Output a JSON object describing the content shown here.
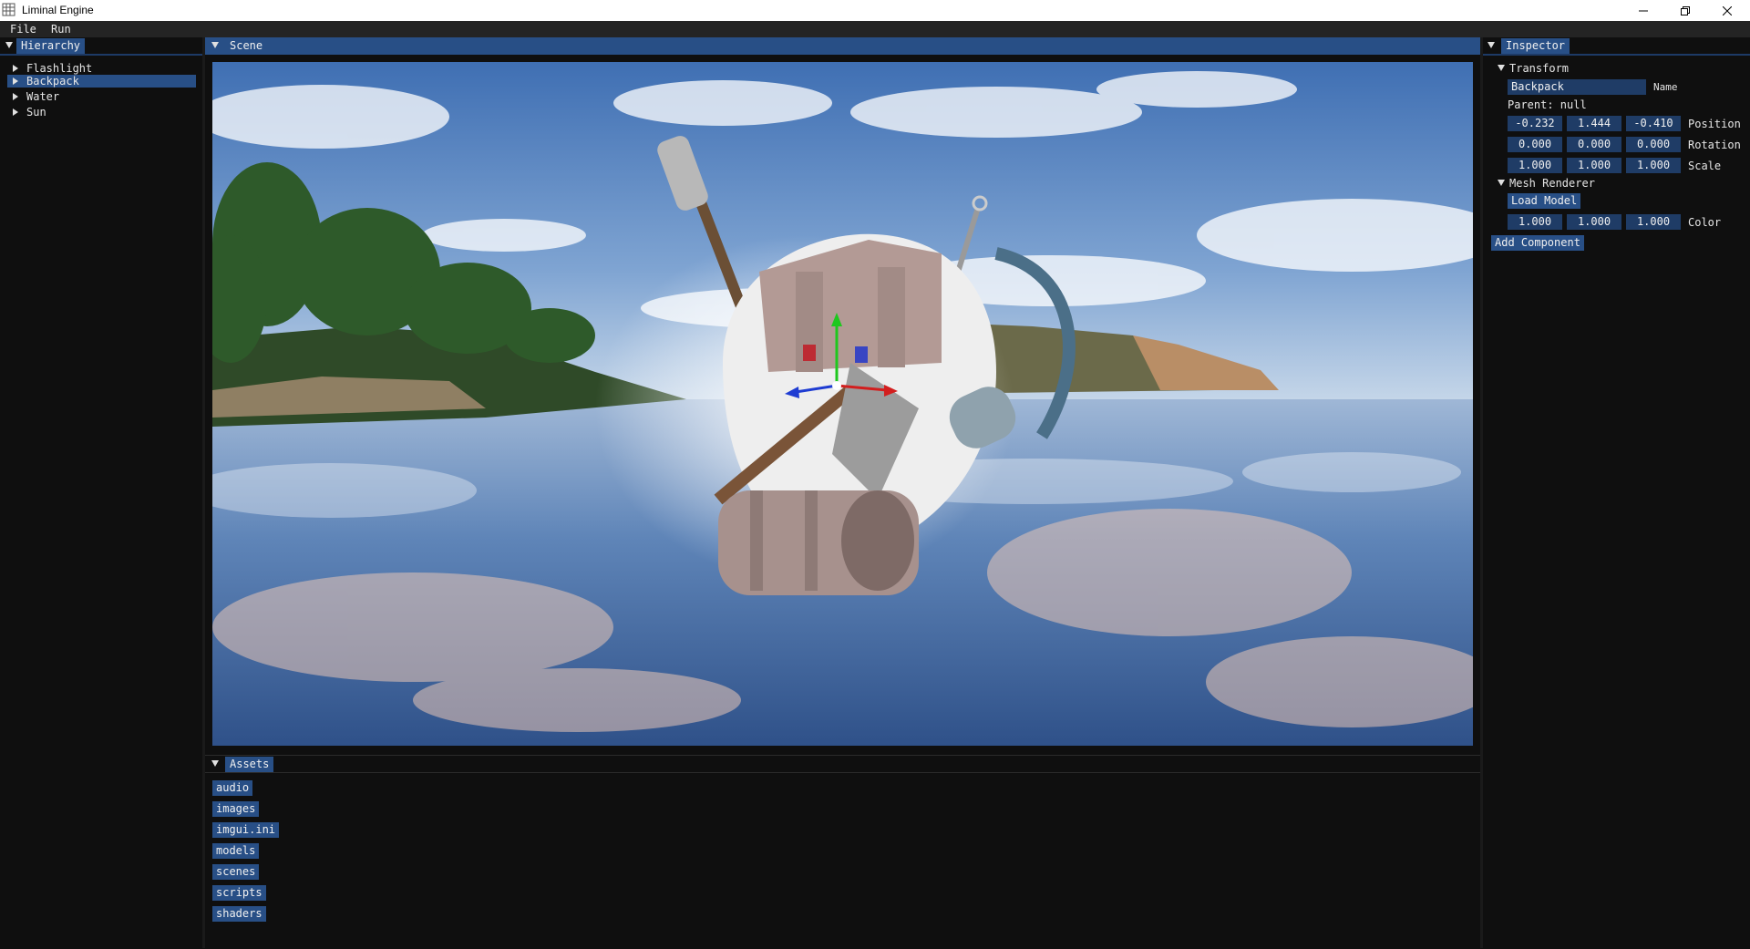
{
  "window": {
    "title": "Liminal Engine",
    "app_icon": "grid-app-icon",
    "controls": [
      "minimize-icon",
      "restore-icon",
      "close-icon"
    ]
  },
  "menu": {
    "file": "File",
    "run": "Run"
  },
  "hierarchy": {
    "tab": "Hierarchy",
    "items": [
      {
        "label": "Flashlight",
        "selected": false
      },
      {
        "label": "Backpack",
        "selected": true
      },
      {
        "label": "Water",
        "selected": false
      },
      {
        "label": "Sun",
        "selected": false
      }
    ]
  },
  "scene": {
    "tab": "Scene",
    "viewport": "3d-scene-backpack-over-water"
  },
  "assets": {
    "tab": "Assets",
    "items": [
      "audio",
      "images",
      "imgui.ini",
      "models",
      "scenes",
      "scripts",
      "shaders"
    ]
  },
  "inspector": {
    "tab": "Inspector",
    "transform": {
      "header": "Transform",
      "name_value": "Backpack",
      "name_label": "Name",
      "parent_text": "Parent: null",
      "position": {
        "label": "Position",
        "values": [
          "-0.232",
          "1.444",
          "-0.410"
        ]
      },
      "rotation": {
        "label": "Rotation",
        "values": [
          "0.000",
          "0.000",
          "0.000"
        ]
      },
      "scale": {
        "label": "Scale",
        "values": [
          "1.000",
          "1.000",
          "1.000"
        ]
      }
    },
    "mesh_renderer": {
      "header": "Mesh Renderer",
      "load_model": "Load Model",
      "color": {
        "label": "Color",
        "values": [
          "1.000",
          "1.000",
          "1.000"
        ]
      }
    },
    "add_component": "Add Component"
  },
  "colors": {
    "accent": "#284f86",
    "field": "#1f3c66",
    "background": "#0f0f0f",
    "gizmo_x": "#d21e1e",
    "gizmo_y": "#1ec81e",
    "gizmo_z": "#1e3cd2"
  }
}
